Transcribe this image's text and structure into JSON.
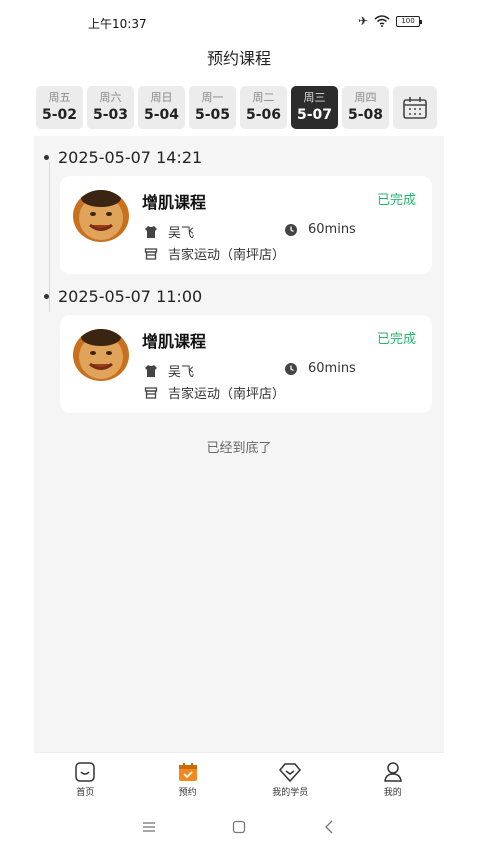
{
  "status_bar": {
    "time": "上午10:37",
    "battery": "100"
  },
  "header": {
    "title": "预约课程"
  },
  "days": [
    {
      "weekday": "周五",
      "date": "5-02"
    },
    {
      "weekday": "周六",
      "date": "5-03"
    },
    {
      "weekday": "周日",
      "date": "5-04"
    },
    {
      "weekday": "周一",
      "date": "5-05"
    },
    {
      "weekday": "周二",
      "date": "5-06"
    },
    {
      "weekday": "周三",
      "date": "5-07"
    },
    {
      "weekday": "周四",
      "date": "5-08"
    }
  ],
  "selected_day_index": 5,
  "bookings": [
    {
      "datetime": "2025-05-07 14:21",
      "course": "增肌课程",
      "status": "已完成",
      "coach": "吴飞",
      "duration": "60mins",
      "location": "吉家运动（南坪店）"
    },
    {
      "datetime": "2025-05-07 11:00",
      "course": "增肌课程",
      "status": "已完成",
      "coach": "吴飞",
      "duration": "60mins",
      "location": "吉家运动（南坪店）"
    }
  ],
  "list_end_text": "已经到底了",
  "tabbar": [
    {
      "label": "首页",
      "icon": "home-icon"
    },
    {
      "label": "预约",
      "icon": "calendar-check-icon"
    },
    {
      "label": "我的学员",
      "icon": "diamond-icon"
    },
    {
      "label": "我的",
      "icon": "user-icon"
    }
  ],
  "colors": {
    "accent": "#f08a1e",
    "status_done": "#25b66c",
    "selected_day": "#2c2c2c"
  }
}
